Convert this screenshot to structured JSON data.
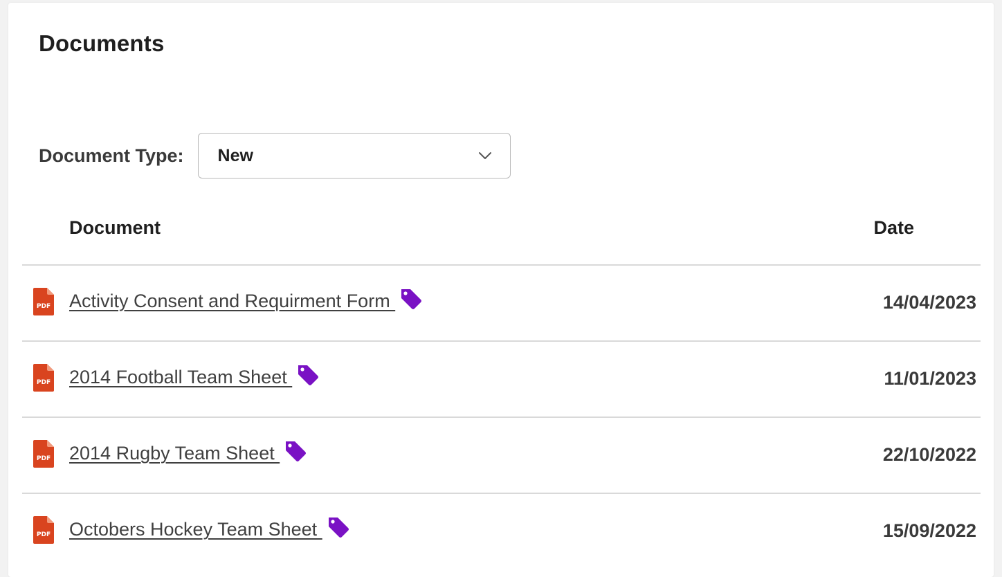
{
  "page": {
    "title": "Documents"
  },
  "filter": {
    "label": "Document Type:",
    "selected": "New"
  },
  "table": {
    "columns": {
      "document": "Document",
      "date": "Date"
    },
    "rows": [
      {
        "name": "Activity Consent and Requirment Form ",
        "date": "14/04/2023",
        "file_icon": "pdf-icon",
        "tag_icon": "tag-icon"
      },
      {
        "name": "2014 Football Team Sheet ",
        "date": "11/01/2023",
        "file_icon": "pdf-icon",
        "tag_icon": "tag-icon"
      },
      {
        "name": "2014 Rugby Team Sheet ",
        "date": "22/10/2022",
        "file_icon": "pdf-icon",
        "tag_icon": "tag-icon"
      },
      {
        "name": "Octobers Hockey Team Sheet ",
        "date": "15/09/2022",
        "file_icon": "pdf-icon",
        "tag_icon": "tag-icon"
      }
    ]
  },
  "colors": {
    "pdf_icon": "#d9441f",
    "tag_icon": "#7a12c4",
    "divider": "#d9d9d9",
    "background": "#f2f2f2",
    "card": "#ffffff"
  }
}
